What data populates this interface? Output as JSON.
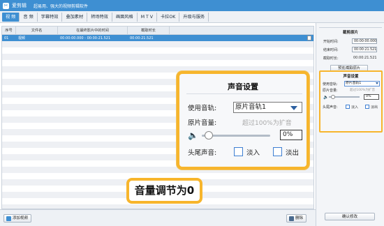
{
  "app": {
    "name": "爱剪辑",
    "slogan": "超易用、强大的视频剪辑软件",
    "accent": "#3e8fd2",
    "highlight": "#f7b52c"
  },
  "menu": {
    "items": [
      "视 频",
      "音 频",
      "字幕特效",
      "叠加素材",
      "转场特效",
      "画面风格",
      "M T V",
      "卡拉OK",
      "升级与服务"
    ]
  },
  "table": {
    "headers": {
      "idx": "序号",
      "name": "文件名",
      "time": "在最终影片中的时间",
      "duration": "截取时长"
    },
    "rows": [
      {
        "idx": "01",
        "name": "视频",
        "time": "00:00:00.000 - 00:00:21.521",
        "duration": "00:00:21.521"
      }
    ]
  },
  "bottombar": {
    "add_label": "添加视频",
    "delete_label": "删除"
  },
  "cut_panel": {
    "title": "截剪原片",
    "start_label": "开始时间:",
    "start_value": "00:00:00.000",
    "end_label": "结束时间:",
    "end_value": "00:00:21.521",
    "dur_label": "截取时长:",
    "dur_value": "00:00:21.521",
    "preview_label": "预览/截取原片"
  },
  "audio_panel": {
    "title": "声音设置",
    "track_label": "使用音轨:",
    "track_value": "原片音轨1",
    "volume_label": "原片音量:",
    "volume_hint": "超过100%为扩音",
    "volume_value": "0%",
    "volume_level": 0,
    "fade_label": "头尾声音:",
    "fade_in_label": "淡入",
    "fade_out_label": "淡出",
    "confirm_label": "确认修改"
  },
  "zoom": {
    "title": "声音设置",
    "track_label": "使用音轨:",
    "track_value": "原片音轨1",
    "volume_label": "原片音量:",
    "volume_hint": "超过100%为扩音",
    "volume_value": "0%",
    "fade_label": "头尾声音:",
    "fade_in_label": "淡入",
    "fade_out_label": "淡出"
  },
  "caption": "音量调节为0"
}
